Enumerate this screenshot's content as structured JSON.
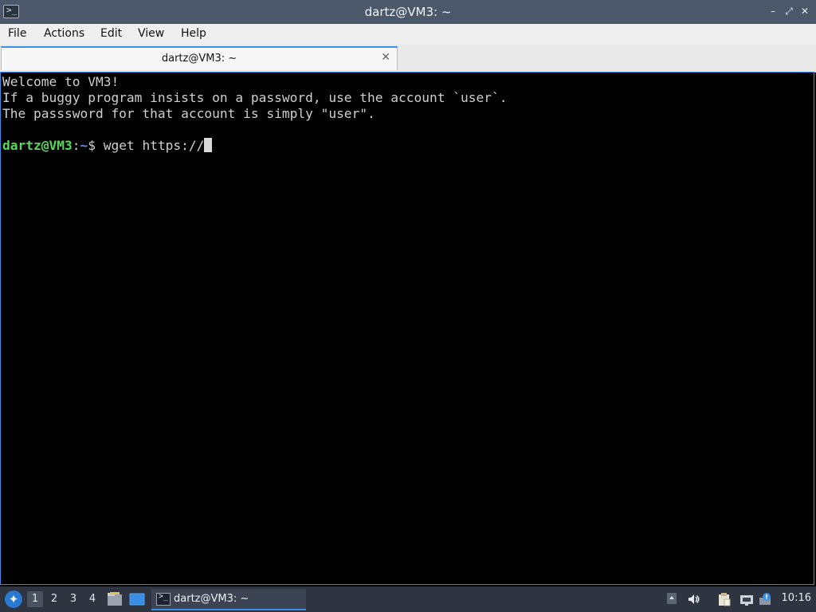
{
  "window": {
    "title": "dartz@VM3: ~",
    "app_icon": ">_",
    "controls": {
      "minimize": "–",
      "restore": "⤢",
      "close": "✕"
    }
  },
  "menu": {
    "items": [
      "File",
      "Actions",
      "Edit",
      "View",
      "Help"
    ]
  },
  "tab": {
    "label": "dartz@VM3: ~",
    "close": "✕"
  },
  "terminal": {
    "lines": [
      "Welcome to VM3!",
      "If a buggy program insists on a password, use the account `user`.",
      "The passsword for that account is simply \"user\"."
    ],
    "prompt_user": "dartz@VM3",
    "prompt_sep": ":",
    "prompt_path": "~",
    "prompt_symbol": "$ ",
    "command": "wget https://"
  },
  "taskbar": {
    "start_icon": "menu-logo",
    "workspaces": [
      "1",
      "2",
      "3",
      "4"
    ],
    "active_workspace": "1",
    "task_label": "dartz@VM3: ~",
    "task_icon": ">_",
    "clock": "10:16"
  },
  "colors": {
    "titlebar": "#4a5869",
    "accent": "#3a8ee6",
    "prompt_user": "#55d95a",
    "prompt_path": "#6f8ff5",
    "taskbar": "#2e3440"
  }
}
